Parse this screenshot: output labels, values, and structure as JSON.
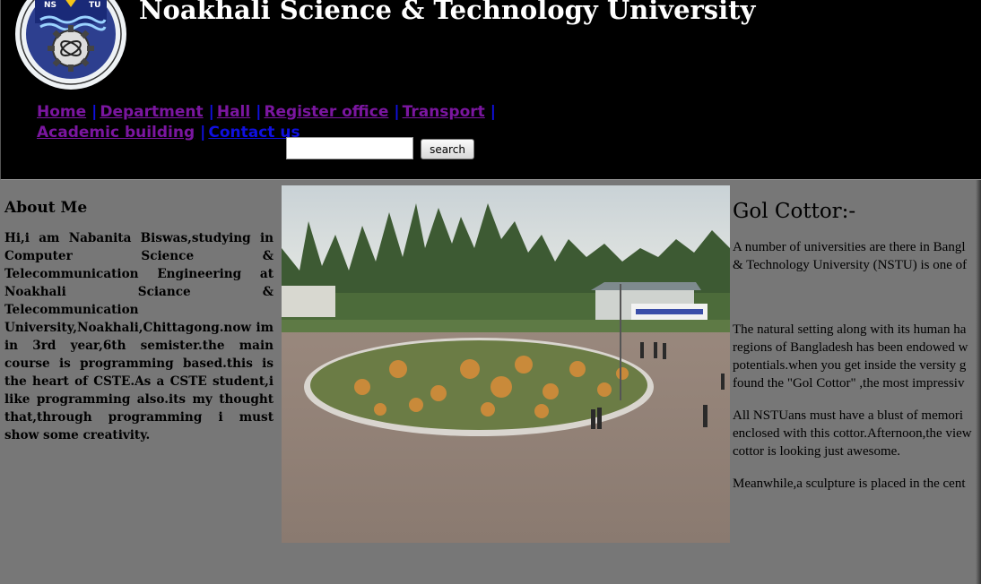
{
  "header": {
    "logo_text": "NSTU",
    "title": "Noakhali Science & Technology University"
  },
  "nav": {
    "items": [
      {
        "label": "Home"
      },
      {
        "label": "Department"
      },
      {
        "label": "Hall"
      },
      {
        "label": "Register office"
      },
      {
        "label": "Transport"
      },
      {
        "label": "Academic building"
      },
      {
        "label": "Contact us"
      }
    ],
    "separator": "|"
  },
  "search": {
    "placeholder": "",
    "button_label": "search"
  },
  "about": {
    "heading": "About Me",
    "text": "Hi,i am Nabanita Biswas,studying in Computer Science & Telecommunication Engineering at Noakhali Sciance & Telecommunication University,Noakhali,Chittagong.now im in 3rd year,6th semister.the main course is programming based.this is the heart of CSTE.As a CSTE student,i like programming also.its my thought that,through programming i must show some creativity."
  },
  "gol_cottor": {
    "heading": "Gol Cottor:-",
    "p1_line1": "A number of universities are there in Bangl",
    "p1_line2": "& Technology University (NSTU) is one of",
    "p2_line1": "The natural setting along with its human ha",
    "p2_line2": "regions of Bangladesh has been endowed w",
    "p2_line3": "potentials.when you get inside the versity g",
    "p2_line4": "found the \"Gol Cottor\" ,the most impressiv",
    "p3_line1": "All NSTUans must have a blust of memori",
    "p3_line2": "enclosed with this cottor.Afternoon,the view",
    "p3_line3": "cottor is looking just awesome.",
    "p4_line1": "Meanwhile,a sculpture is placed in the cent"
  },
  "colors": {
    "header_bg": "#000000",
    "page_bg": "#777777",
    "nav_link": "#7b16a0",
    "nav_link_visited_blue": "#1010e0"
  }
}
